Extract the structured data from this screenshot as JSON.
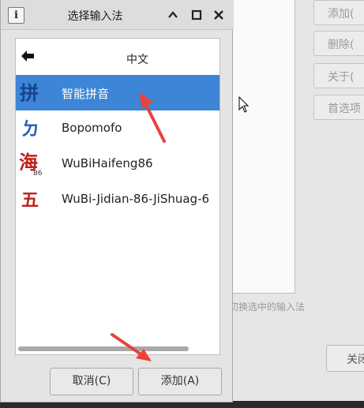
{
  "dialog": {
    "title": "选择输入法",
    "app_icon_glyph": "i",
    "language_label": "中文",
    "items": [
      {
        "label": "智能拼音",
        "icon": "pinyin-icon",
        "icon_glyph": "拼",
        "selected": true
      },
      {
        "label": "Bopomofo",
        "icon": "bopomofo-icon",
        "icon_glyph": "ㄉ",
        "selected": false
      },
      {
        "label": "WuBiHaifeng86",
        "icon": "wubi-haifeng-icon",
        "icon_glyph": "海",
        "icon_sub": "86",
        "selected": false
      },
      {
        "label": "WuBi-Jidian-86-JiShuag-6",
        "icon": "wubi-jidian-icon",
        "icon_glyph": "五",
        "selected": false
      }
    ],
    "cancel_label": "取消(C)",
    "add_label": "添加(A)"
  },
  "background_window": {
    "buttons": [
      "添加(",
      "删除(",
      "关于(",
      "首选项"
    ],
    "hint_text": "切换选中的输入法",
    "close_label": "关闭"
  },
  "colors": {
    "selection": "#3d85d6",
    "annotation": "#e8443a",
    "dialog_bg": "#e4e4e4"
  }
}
